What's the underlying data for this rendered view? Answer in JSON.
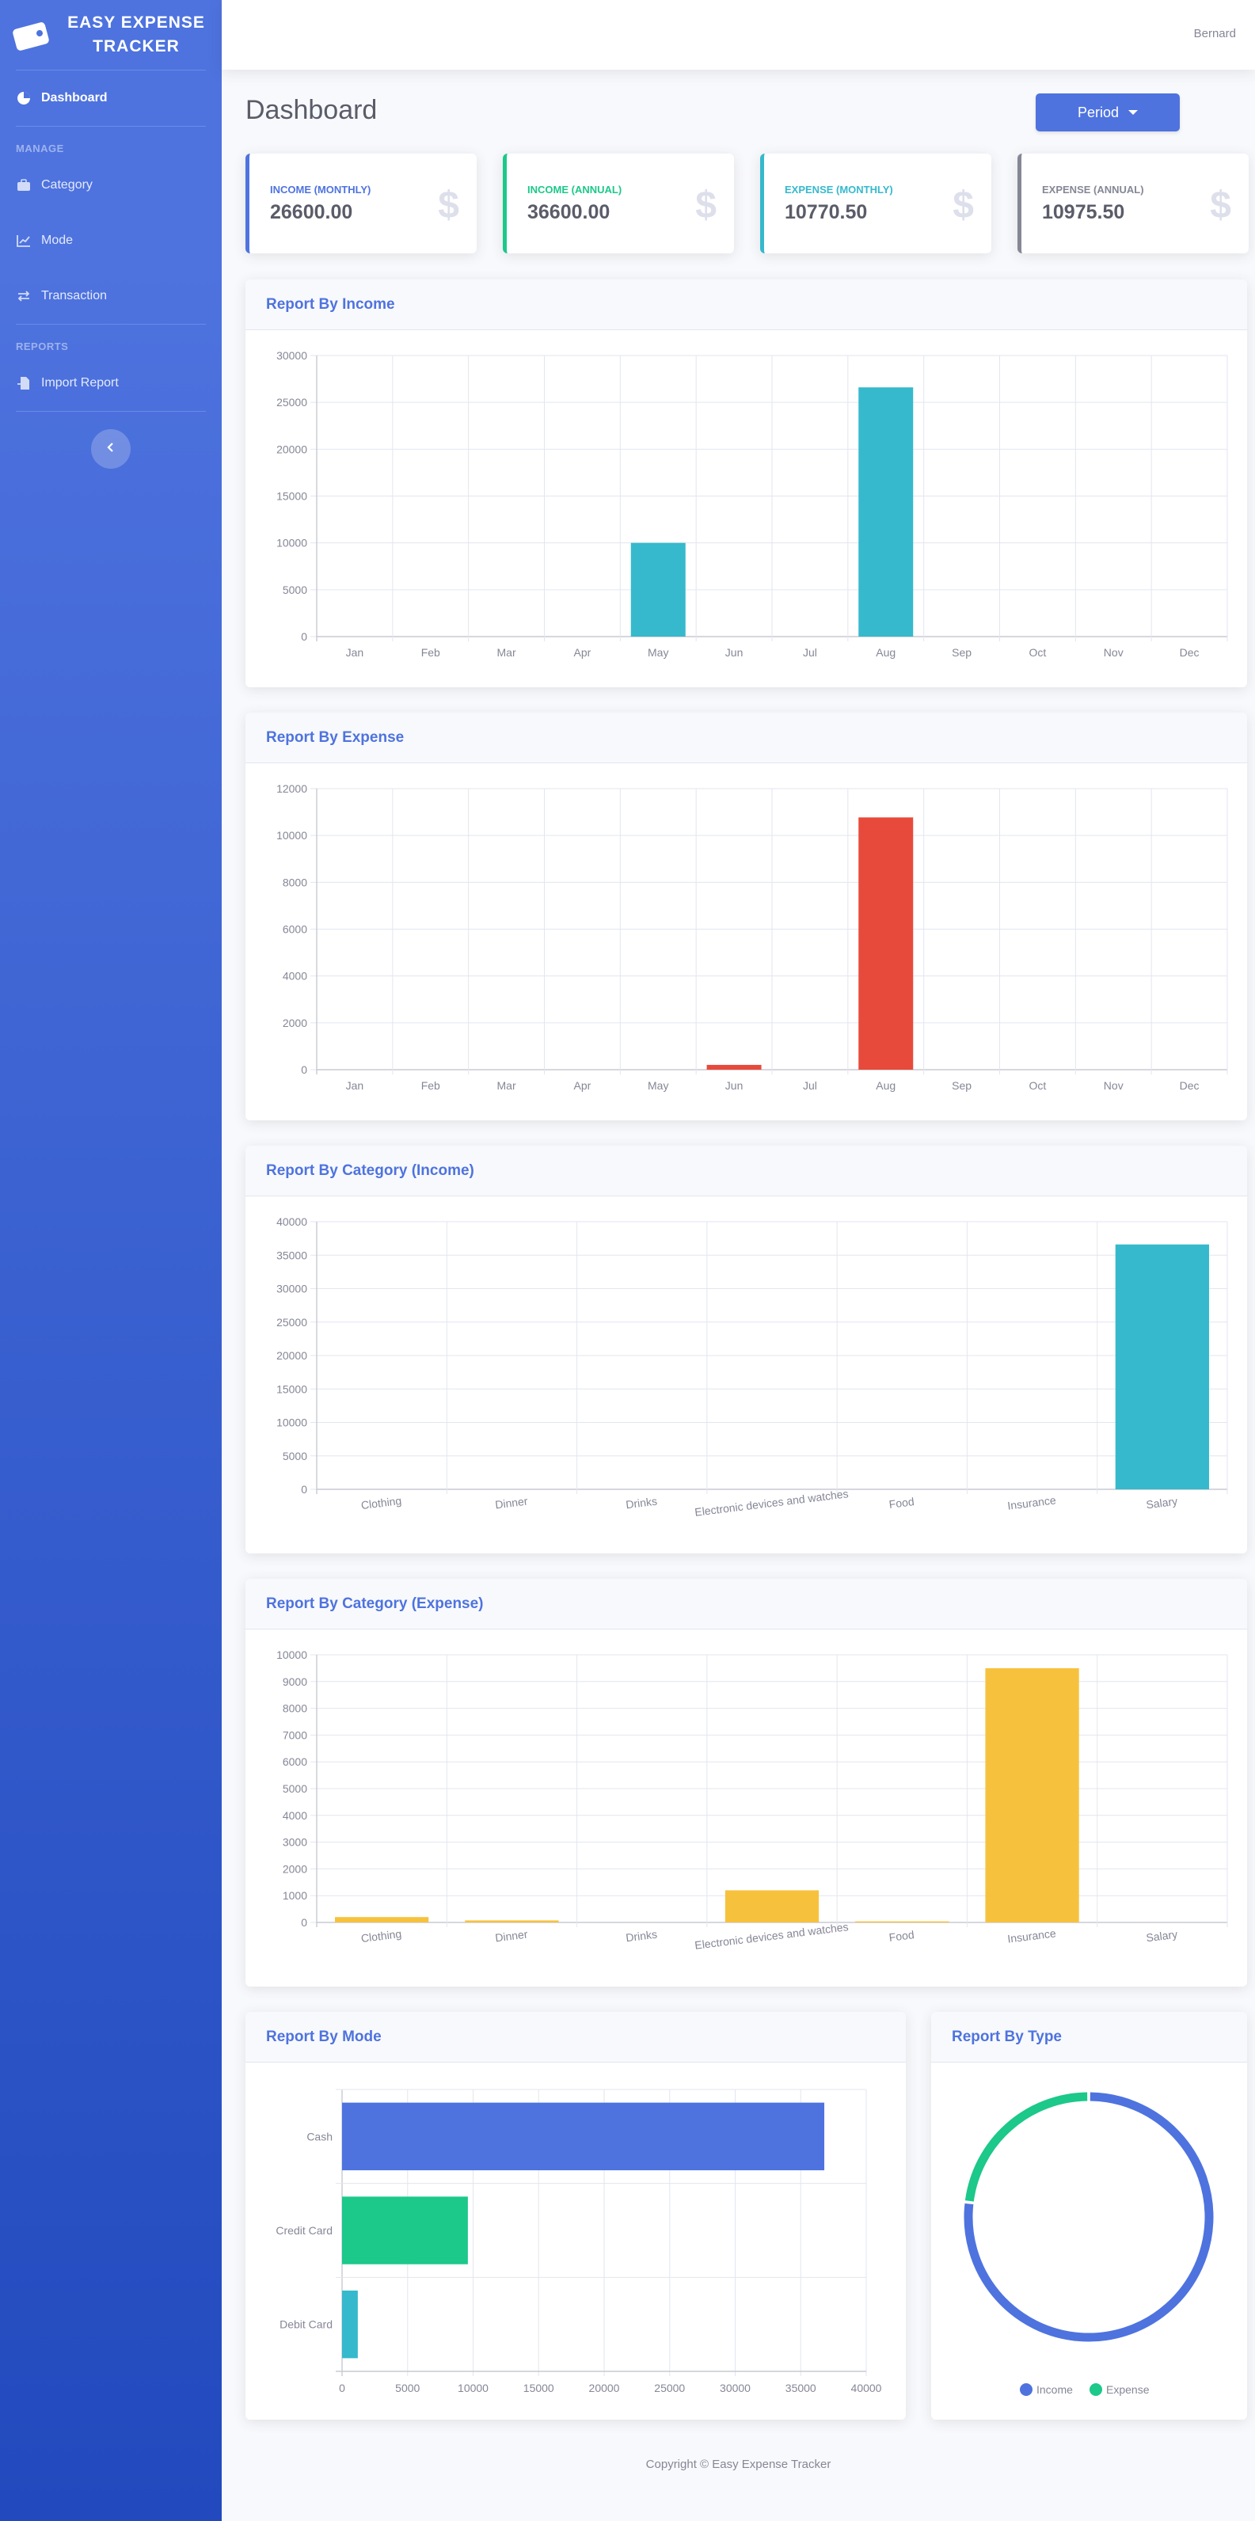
{
  "brand": {
    "line1": "EASY EXPENSE",
    "line2": "TRACKER"
  },
  "sidebar": {
    "dashboard": "Dashboard",
    "manage_heading": "MANAGE",
    "manage_items": [
      "Category",
      "Mode",
      "Transaction"
    ],
    "reports_heading": "REPORTS",
    "reports_items": [
      "Import Report"
    ]
  },
  "topbar": {
    "user": "Bernard"
  },
  "page": {
    "title": "Dashboard",
    "period_label": "Period"
  },
  "stats": [
    {
      "label": "INCOME (MONTHLY)",
      "value": "26600.00",
      "icon": "$",
      "color": "#4e73df"
    },
    {
      "label": "INCOME (ANNUAL)",
      "value": "36600.00",
      "icon": "$",
      "color": "#1cc88a"
    },
    {
      "label": "EXPENSE (MONTHLY)",
      "value": "10770.50",
      "icon": "$",
      "color": "#36b9cc"
    },
    {
      "label": "EXPENSE (ANNUAL)",
      "value": "10975.50",
      "icon": "$",
      "color": "#858796"
    }
  ],
  "cards": {
    "income": "Report By Income",
    "expense": "Report By Expense",
    "cat_income": "Report By Category (Income)",
    "cat_expense": "Report By Category (Expense)",
    "mode": "Report By Mode",
    "type": "Report By Type"
  },
  "footer": "Copyright © Easy Expense Tracker",
  "chart_data": [
    {
      "id": "income",
      "type": "bar",
      "categories": [
        "Jan",
        "Feb",
        "Mar",
        "Apr",
        "May",
        "Jun",
        "Jul",
        "Aug",
        "Sep",
        "Oct",
        "Nov",
        "Dec"
      ],
      "values": [
        0,
        0,
        0,
        0,
        10000,
        0,
        0,
        26600,
        0,
        0,
        0,
        0
      ],
      "ylim": [
        0,
        30000
      ],
      "yticks": [
        0,
        5000,
        10000,
        15000,
        20000,
        25000,
        30000
      ],
      "color": "#36b9cc",
      "grid": true
    },
    {
      "id": "expense",
      "type": "bar",
      "categories": [
        "Jan",
        "Feb",
        "Mar",
        "Apr",
        "May",
        "Jun",
        "Jul",
        "Aug",
        "Sep",
        "Oct",
        "Nov",
        "Dec"
      ],
      "values": [
        0,
        0,
        0,
        0,
        0,
        205,
        0,
        10770.5,
        0,
        0,
        0,
        0
      ],
      "ylim": [
        0,
        12000
      ],
      "yticks": [
        0,
        2000,
        4000,
        6000,
        8000,
        10000,
        12000
      ],
      "color": "#e74a3b",
      "grid": true
    },
    {
      "id": "cat_income",
      "type": "bar",
      "categories": [
        "Clothing",
        "Dinner",
        "Drinks",
        "Electronic devices and watches",
        "Food",
        "Insurance",
        "Salary"
      ],
      "values": [
        0,
        0,
        0,
        0,
        0,
        0,
        36600
      ],
      "ylim": [
        0,
        40000
      ],
      "yticks": [
        0,
        5000,
        10000,
        15000,
        20000,
        25000,
        30000,
        35000,
        40000
      ],
      "color": "#36b9cc",
      "grid": true
    },
    {
      "id": "cat_expense",
      "type": "bar",
      "categories": [
        "Clothing",
        "Dinner",
        "Drinks",
        "Electronic devices and watches",
        "Food",
        "Insurance",
        "Salary"
      ],
      "values": [
        200,
        75,
        0,
        1200,
        40,
        9500,
        0
      ],
      "ylim": [
        0,
        10000
      ],
      "yticks": [
        0,
        1000,
        2000,
        3000,
        4000,
        5000,
        6000,
        7000,
        8000,
        9000,
        10000
      ],
      "color": "#f6c23e",
      "grid": true
    },
    {
      "id": "mode",
      "type": "bar",
      "orientation": "horizontal",
      "categories": [
        "Cash",
        "Credit Card",
        "Debit Card"
      ],
      "values": [
        36800,
        9600,
        1200
      ],
      "colors": [
        "#4e73df",
        "#1cc88a",
        "#36b9cc"
      ],
      "xlim": [
        0,
        40000
      ],
      "xticks": [
        0,
        5000,
        10000,
        15000,
        20000,
        25000,
        30000,
        35000,
        40000
      ],
      "grid": true
    },
    {
      "id": "type",
      "type": "pie",
      "style": "doughnut",
      "labels": [
        "Income",
        "Expense"
      ],
      "values": [
        36600,
        10975.5
      ],
      "colors": [
        "#4e73df",
        "#1cc88a"
      ],
      "legend": "bottom"
    }
  ]
}
